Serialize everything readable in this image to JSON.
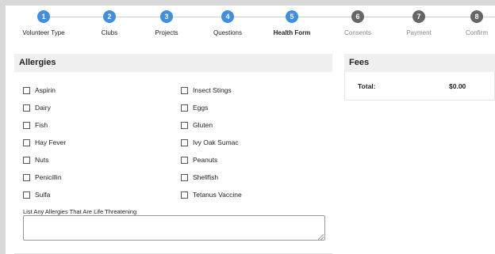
{
  "stepper": {
    "steps": [
      {
        "number": "1",
        "label": "Volunteer Type",
        "state": "done"
      },
      {
        "number": "2",
        "label": "Clubs",
        "state": "done"
      },
      {
        "number": "3",
        "label": "Projects",
        "state": "done"
      },
      {
        "number": "4",
        "label": "Questions",
        "state": "done"
      },
      {
        "number": "5",
        "label": "Health Form",
        "state": "active"
      },
      {
        "number": "6",
        "label": "Consents",
        "state": "todo"
      },
      {
        "number": "7",
        "label": "Payment",
        "state": "todo"
      },
      {
        "number": "8",
        "label": "Confirm",
        "state": "todo"
      }
    ]
  },
  "allergies": {
    "title": "Allergies",
    "left_column": [
      "Aspirin",
      "Dairy",
      "Fish",
      "Hay Fever",
      "Nuts",
      "Penicillin",
      "Sulfa"
    ],
    "right_column": [
      "Insect Stings",
      "Eggs",
      "Gluten",
      "Ivy Oak Sumac",
      "Peanuts",
      "Shellfish",
      "Tetanus Vaccine"
    ],
    "life_threatening_label": "List Any Allergies That Are Life Threatening",
    "life_threatening_value": ""
  },
  "fees": {
    "title": "Fees",
    "total_label": "Total:",
    "total_value": "$0.00"
  },
  "colors": {
    "step_done": "#3f8fe0",
    "step_todo": "#666666",
    "panel_header_bg": "#f0f0f0"
  }
}
